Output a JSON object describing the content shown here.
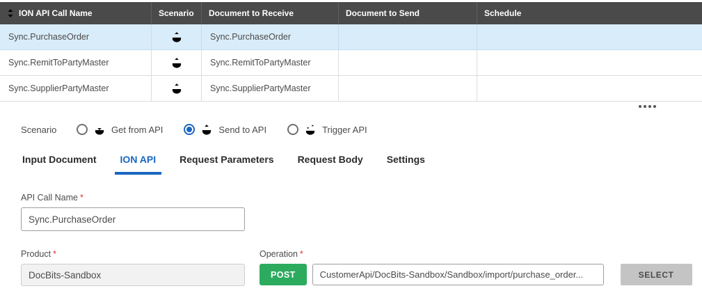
{
  "colors": {
    "header_bg": "#4a4a4a",
    "selected_row_bg": "#d9ecf9",
    "accent_blue": "#1a66c0",
    "post_green": "#2cab5f",
    "required_red": "#d9352c",
    "select_button_bg": "#c4c4c4"
  },
  "icons": {
    "sort": "sort-arrows-icon",
    "get_from_api": "get-from-api-icon",
    "send_to_api": "send-to-api-icon",
    "trigger_api": "trigger-api-icon",
    "row_scenario": "send-to-api-icon",
    "drag_handle": "drag-handle-dots-icon"
  },
  "table": {
    "columns": [
      "ION API Call Name",
      "Scenario",
      "Document to Receive",
      "Document to Send",
      "Schedule"
    ],
    "rows": [
      {
        "name": "Sync.PurchaseOrder",
        "document_to_receive": "Sync.PurchaseOrder",
        "document_to_send": "",
        "schedule": "",
        "selected": true
      },
      {
        "name": "Sync.RemitToPartyMaster",
        "document_to_receive": "Sync.RemitToPartyMaster",
        "document_to_send": "",
        "schedule": "",
        "selected": false
      },
      {
        "name": "Sync.SupplierPartyMaster",
        "document_to_receive": "Sync.SupplierPartyMaster",
        "document_to_send": "",
        "schedule": "",
        "selected": false
      }
    ]
  },
  "scenario": {
    "label": "Scenario",
    "options": [
      {
        "label": "Get from API",
        "selected": false
      },
      {
        "label": "Send to API",
        "selected": true
      },
      {
        "label": "Trigger API",
        "selected": false
      }
    ]
  },
  "tabs": [
    {
      "label": "Input Document",
      "active": false
    },
    {
      "label": "ION API",
      "active": true
    },
    {
      "label": "Request Parameters",
      "active": false
    },
    {
      "label": "Request Body",
      "active": false
    },
    {
      "label": "Settings",
      "active": false
    }
  ],
  "form": {
    "asterisk": "*",
    "api_call_name": {
      "label": "API Call Name",
      "value": "Sync.PurchaseOrder"
    },
    "product": {
      "label": "Product",
      "value": "DocBits-Sandbox"
    },
    "operation": {
      "label": "Operation",
      "method": "POST",
      "value": "CustomerApi/DocBits-Sandbox/Sandbox/import/purchase_order...",
      "select_button": "SELECT"
    }
  }
}
